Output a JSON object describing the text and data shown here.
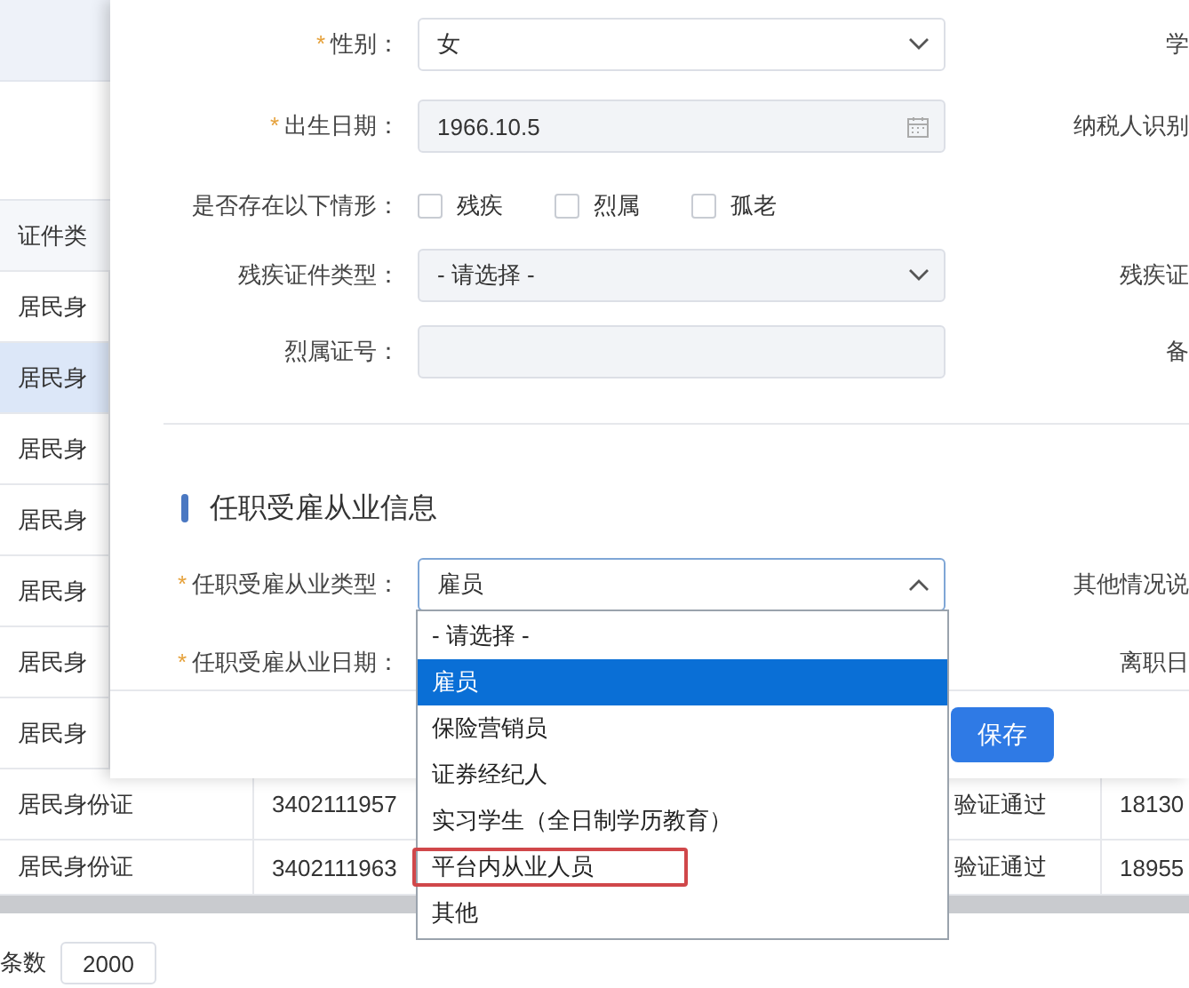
{
  "page": {
    "table": {
      "header": "证件类",
      "rows": [
        {
          "cells": [
            "居民身"
          ],
          "selected": false
        },
        {
          "cells": [
            "居民身"
          ],
          "selected": true
        },
        {
          "cells": [
            "居民身"
          ],
          "selected": false
        },
        {
          "cells": [
            "居民身"
          ],
          "selected": false
        },
        {
          "cells": [
            "居民身"
          ],
          "selected": false
        },
        {
          "cells": [
            "居民身"
          ],
          "selected": false
        },
        {
          "cells": [
            "居民身"
          ],
          "selected": false
        },
        {
          "cells": [
            "居民身份证",
            "3402111957",
            "验证通过",
            "18130"
          ],
          "selected": false
        },
        {
          "cells": [
            "居民身份证",
            "3402111963",
            "验证通过",
            "18955"
          ],
          "selected": false
        }
      ]
    },
    "footer": {
      "label": "条数",
      "page_size": "2000"
    }
  },
  "dialog": {
    "fields": [
      {
        "kind": "select",
        "mark": "*",
        "label": "性别：",
        "value": "女",
        "disabled": false,
        "right_label": "学"
      },
      {
        "kind": "date",
        "mark": "*",
        "label": "出生日期：",
        "value": "1966.10.5",
        "disabled": true,
        "right_label": "纳税人识别"
      },
      {
        "kind": "checkboxes",
        "label": "是否存在以下情形：",
        "options": [
          {
            "label": "残疾",
            "checked": false
          },
          {
            "label": "烈属",
            "checked": false
          },
          {
            "label": "孤老",
            "checked": false
          }
        ]
      },
      {
        "kind": "select",
        "label": "残疾证件类型：",
        "value": "- 请选择 -",
        "disabled": true,
        "right_label": "残疾证"
      },
      {
        "kind": "text",
        "label": "烈属证号：",
        "disabled": true,
        "right_label": "备"
      }
    ],
    "section": {
      "title": "任职受雇从业信息",
      "fields": [
        {
          "kind": "select",
          "mark": "*",
          "label": "任职受雇从业类型：",
          "value": "雇员",
          "disabled": false,
          "expanded": true,
          "right_label": "其他情况说"
        },
        {
          "kind": "covered",
          "mark": "*",
          "label": "任职受雇从业日期：",
          "right_label": "离职日"
        }
      ]
    },
    "save_button": "保存"
  },
  "dropdown": {
    "options": [
      {
        "label": "- 请选择 -",
        "selected": false,
        "highlighted": false
      },
      {
        "label": "雇员",
        "selected": true,
        "highlighted": false
      },
      {
        "label": "保险营销员",
        "selected": false,
        "highlighted": false
      },
      {
        "label": "证券经纪人",
        "selected": false,
        "highlighted": false
      },
      {
        "label": "实习学生（全日制学历教育）",
        "selected": false,
        "highlighted": false
      },
      {
        "label": "平台内从业人员",
        "selected": false,
        "highlighted": true
      },
      {
        "label": "其他",
        "selected": false,
        "highlighted": false
      }
    ]
  }
}
